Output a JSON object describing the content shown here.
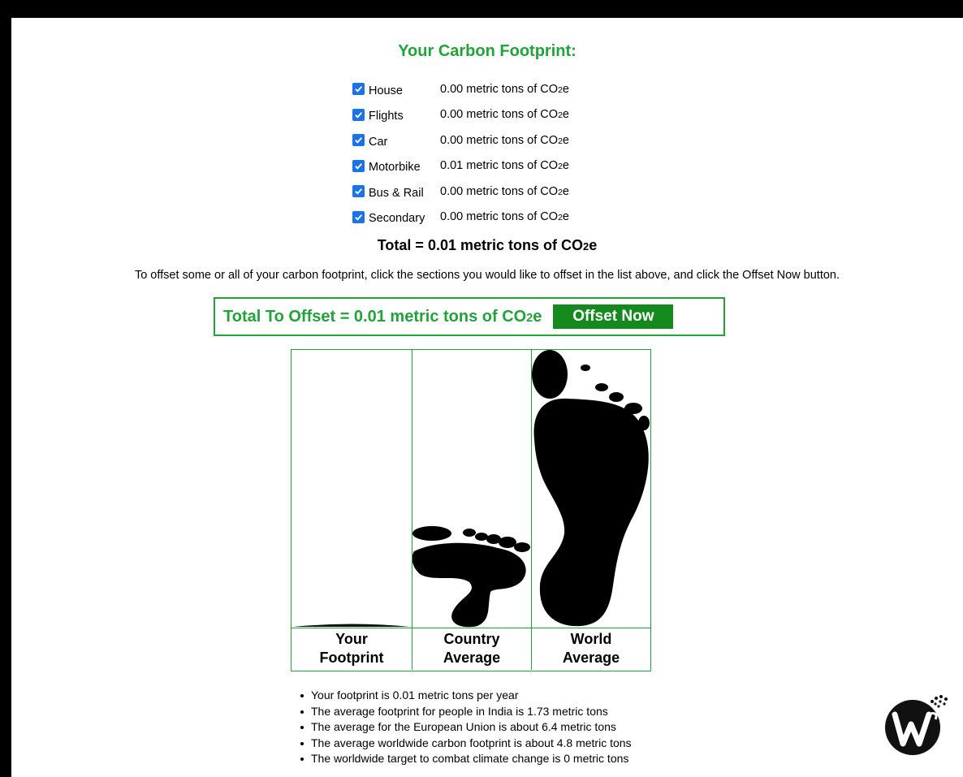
{
  "title": "Your Carbon Footprint:",
  "categories": [
    {
      "label": "House",
      "value": "0.00 metric tons of CO",
      "sub": "2",
      "suffix": "e",
      "checked": true
    },
    {
      "label": "Flights",
      "value": "0.00 metric tons of CO",
      "sub": "2",
      "suffix": "e",
      "checked": true
    },
    {
      "label": "Car",
      "value": "0.00 metric tons of CO",
      "sub": "2",
      "suffix": "e",
      "checked": true
    },
    {
      "label": "Motorbike",
      "value": "0.01 metric tons of CO",
      "sub": "2",
      "suffix": "e",
      "checked": true
    },
    {
      "label": "Bus & Rail",
      "value": "0.00 metric tons of CO",
      "sub": "2",
      "suffix": "e",
      "checked": true
    },
    {
      "label": "Secondary",
      "value": "0.00 metric tons of CO",
      "sub": "2",
      "suffix": "e",
      "checked": true
    }
  ],
  "total": {
    "prefix": "Total = 0.01 metric tons of CO",
    "sub": "2",
    "suffix": "e"
  },
  "offset_instructions": "To offset some or all of your carbon footprint, click the sections you would like to offset in the list above, and click the Offset Now button.",
  "offset": {
    "prefix": "Total To Offset = 0.01 metric tons of CO",
    "sub": "2",
    "suffix": "e",
    "button_label": "Offset Now"
  },
  "comparison": [
    {
      "label": "Your\nFootprint",
      "value_tons": 0.01
    },
    {
      "label": "Country\nAverage",
      "value_tons": 1.73
    },
    {
      "label": "World\nAverage",
      "value_tons": 4.8
    }
  ],
  "facts": [
    "Your footprint is 0.01 metric tons per year",
    "The average footprint for people in India is 1.73 metric tons",
    "The average for the European Union is about 6.4 metric tons",
    "The average worldwide carbon footprint is about 4.8 metric tons",
    "The worldwide target to combat climate change is 0 metric tons"
  ],
  "colors": {
    "accent": "#22a33a",
    "button": "#148a1e",
    "checkbox": "#1a73e8"
  }
}
